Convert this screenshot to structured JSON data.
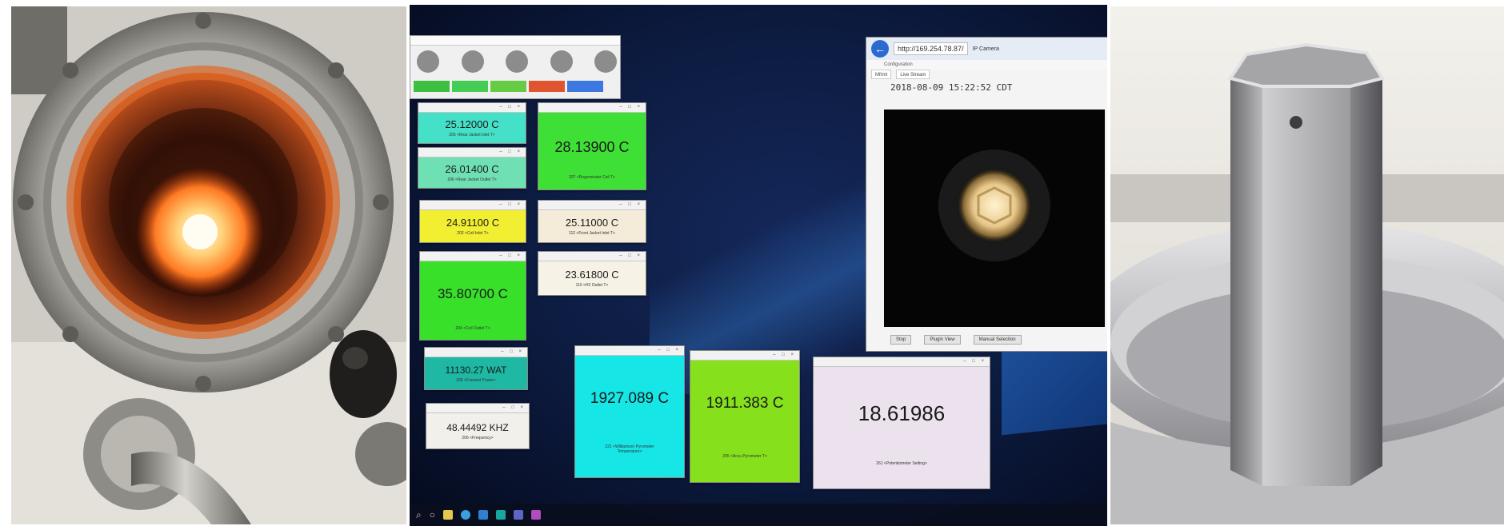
{
  "monitor": {
    "controller": {
      "buttons": [
        {
          "color": "#3fbf3f"
        },
        {
          "color": "#44cc55"
        },
        {
          "color": "#66cc44"
        },
        {
          "color": "#e05530"
        },
        {
          "color": "#3c78e0"
        }
      ]
    },
    "tiles": [
      {
        "id": "rear-jacket-inlet",
        "value": "25.12000 C",
        "label": "205 <Rear Jacket Inlet T>",
        "bg": "#45e0c8"
      },
      {
        "id": "rear-jacket-outlet",
        "value": "26.01400 C",
        "label": "206 <Rear Jacket Outlet T>",
        "bg": "#6fe0b4"
      },
      {
        "id": "regenerator-coil",
        "value": "28.13900 C",
        "label": "207 <Regenerator Coil T>",
        "bg": "#3ee036"
      },
      {
        "id": "coil-inlet",
        "value": "24.91100 C",
        "label": "202 <Coil Inlet T>",
        "bg": "#f2ee32"
      },
      {
        "id": "front-jacket-inlet",
        "value": "25.11000 C",
        "label": "112 <Front Jacket Inlet T>",
        "bg": "#f4ecd8"
      },
      {
        "id": "coil-outlet",
        "value": "35.80700 C",
        "label": "204 <Coil Outlet T>",
        "bg": "#38e02a"
      },
      {
        "id": "h2-outlet",
        "value": "23.61800 C",
        "label": "110 <H2 Outlet T>",
        "bg": "#f6f3e6"
      },
      {
        "id": "forward-power",
        "value": "11130.27 WAT",
        "label": "206 <Forward Power>",
        "bg": "#1fb8a4"
      },
      {
        "id": "frequency",
        "value": "48.44492 KHZ",
        "label": "206 <Frequency>",
        "bg": "#f2f0ea"
      },
      {
        "id": "williamson-pyrometer",
        "value": "1927.089 C",
        "label": "221 <Williamson Pyrometer Temperature>",
        "bg": "#16e6e6"
      },
      {
        "id": "accu-pyrometer",
        "value": "1911.383 C",
        "label": "205 <Accu Pyrometer T>",
        "bg": "#86e01c"
      },
      {
        "id": "potentiometer",
        "value": "18.61986",
        "label": "261 <Potentiometer Setting>",
        "bg": "#ece2ee"
      }
    ],
    "browser": {
      "url": "http://169.254.78.87/",
      "tab_title": "IP Camera",
      "menu": "Configuration",
      "tabs": [
        "Mfrmt",
        "Live Stream"
      ],
      "timestamp": "2018-08-09 15:22:52 CDT",
      "buttons": [
        "Stop",
        "Plugin View",
        "Manual Selection"
      ]
    }
  }
}
